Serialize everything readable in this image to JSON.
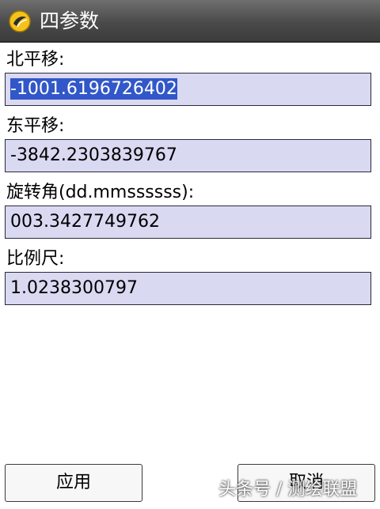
{
  "window": {
    "title": "四参数",
    "icon": "app-icon"
  },
  "fields": [
    {
      "label": "北平移:",
      "value": "-1001.6196726402",
      "selected": true
    },
    {
      "label": "东平移:",
      "value": "-3842.2303839767",
      "selected": false
    },
    {
      "label": "旋转角(dd.mmssssss):",
      "value": "003.3427749762",
      "selected": false
    },
    {
      "label": "比例尺:",
      "value": "1.0238300797",
      "selected": false
    }
  ],
  "buttons": {
    "apply": "应用",
    "cancel": "取消"
  },
  "watermark": "头条号 / 测绘联盟"
}
